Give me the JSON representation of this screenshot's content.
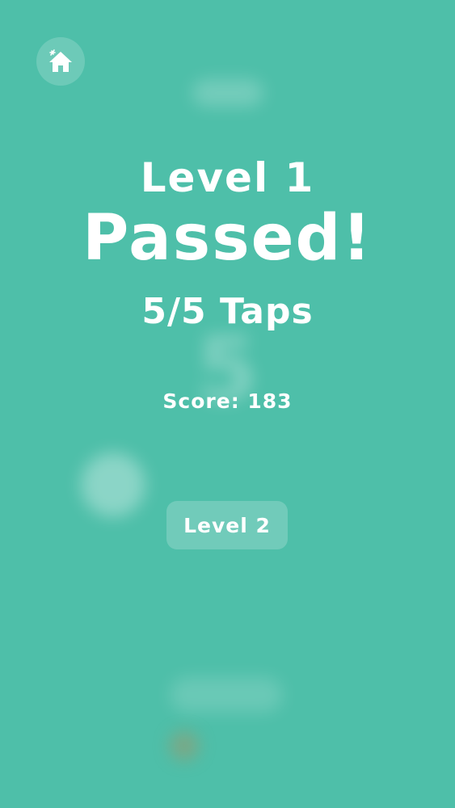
{
  "result": {
    "level_label": "Level 1",
    "status_label": "Passed!",
    "taps_label": "5/5 Taps",
    "score_label": "Score: 183"
  },
  "actions": {
    "home_icon": "home-icon",
    "next_level_label": "Level 2"
  },
  "background": {
    "blurred_number": "5"
  },
  "colors": {
    "background": "#4ebfa9",
    "text": "#ffffff"
  }
}
